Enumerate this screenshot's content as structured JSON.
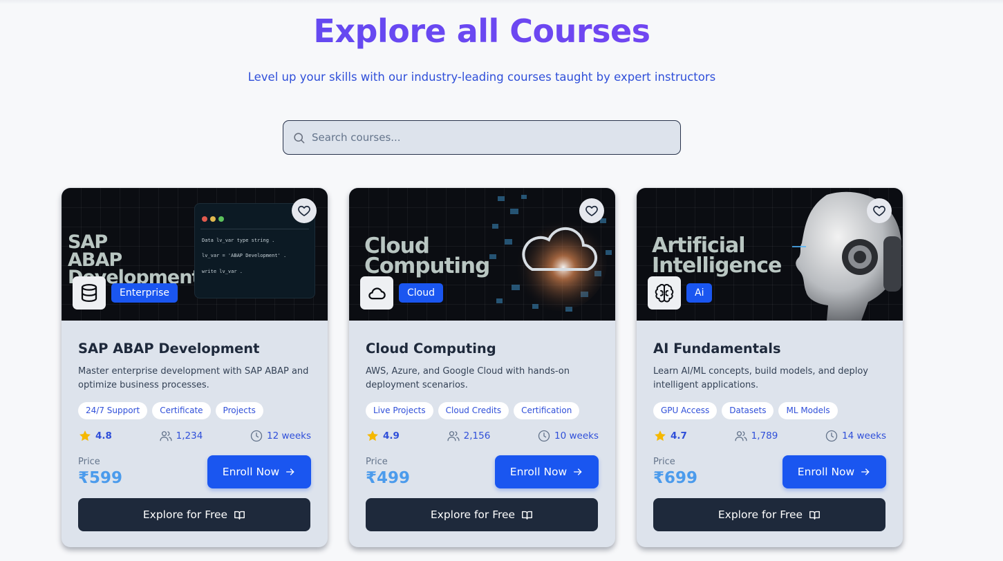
{
  "header": {
    "title": "Explore all Courses",
    "subtitle": "Level up your skills with our industry-leading courses taught by expert instructors"
  },
  "search": {
    "placeholder": "Search courses..."
  },
  "courses": [
    {
      "media_title": "SAP ABAP Development",
      "media_lines": [
        "SAP",
        "ABAP",
        "Development"
      ],
      "code_lines": [
        "Data lv_var type string .",
        "lv_var = 'ABAP Development' .",
        " write  lv_var ."
      ],
      "category_icon": "database-icon",
      "category": "Enterprise",
      "name": "SAP ABAP Development",
      "description": "Master enterprise development with SAP ABAP and optimize business processes.",
      "tags": [
        "24/7 Support",
        "Certificate",
        "Projects"
      ],
      "rating": "4.8",
      "students": "1,234",
      "duration": "12 weeks",
      "price_label": "Price",
      "price": "₹599",
      "enroll_label": "Enroll Now",
      "explore_label": "Explore for Free"
    },
    {
      "media_title": "Cloud Computing",
      "media_lines": [
        "Cloud",
        "Computing"
      ],
      "category_icon": "cloud-icon",
      "category": "Cloud",
      "name": "Cloud Computing",
      "description": "AWS, Azure, and Google Cloud with hands-on deployment scenarios.",
      "tags": [
        "Live Projects",
        "Cloud Credits",
        "Certification"
      ],
      "rating": "4.9",
      "students": "2,156",
      "duration": "10 weeks",
      "price_label": "Price",
      "price": "₹499",
      "enroll_label": "Enroll Now",
      "explore_label": "Explore for Free"
    },
    {
      "media_title": "Artificial Intelligence",
      "media_lines": [
        "Artificial",
        "Intelligence"
      ],
      "category_icon": "brain-icon",
      "category": "Ai",
      "name": "AI Fundamentals",
      "description": "Learn AI/ML concepts, build models, and deploy intelligent applications.",
      "tags": [
        "GPU Access",
        "Datasets",
        "ML Models"
      ],
      "rating": "4.7",
      "students": "1,789",
      "duration": "14 weeks",
      "price_label": "Price",
      "price": "₹699",
      "enroll_label": "Enroll Now",
      "explore_label": "Explore for Free"
    }
  ],
  "colors": {
    "title_gradient_start": "#5a4cf0",
    "title_gradient_end": "#7b43f2",
    "accent_blue": "#1a56f0",
    "price_blue": "#4b9bec",
    "star_yellow": "#f5b800",
    "dark_button": "#1e293b",
    "card_bg": "#dde3ec"
  }
}
